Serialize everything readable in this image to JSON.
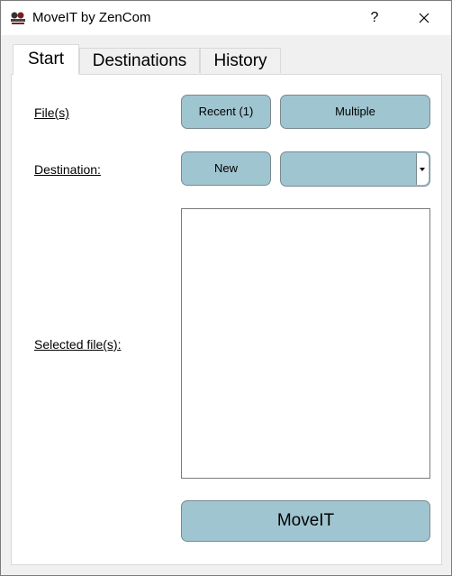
{
  "window": {
    "title": "MoveIT by ZenCom",
    "help_label": "?",
    "icon": "moveit-app-icon",
    "close_icon": "close-icon"
  },
  "tabs": [
    {
      "label": "Start",
      "active": true
    },
    {
      "label": "Destinations",
      "active": false
    },
    {
      "label": "History",
      "active": false
    }
  ],
  "start": {
    "files_label": "File(s)",
    "recent_label": "Recent (1)",
    "multiple_label": "Multiple",
    "destination_label": "Destination:",
    "new_label": "New",
    "destination_value": "",
    "selected_files_label": "Selected file(s):",
    "selected_files": [],
    "moveit_label": "MoveIT"
  },
  "colors": {
    "button_fill": "#9fc5d0",
    "button_border": "#7a8a8e"
  }
}
